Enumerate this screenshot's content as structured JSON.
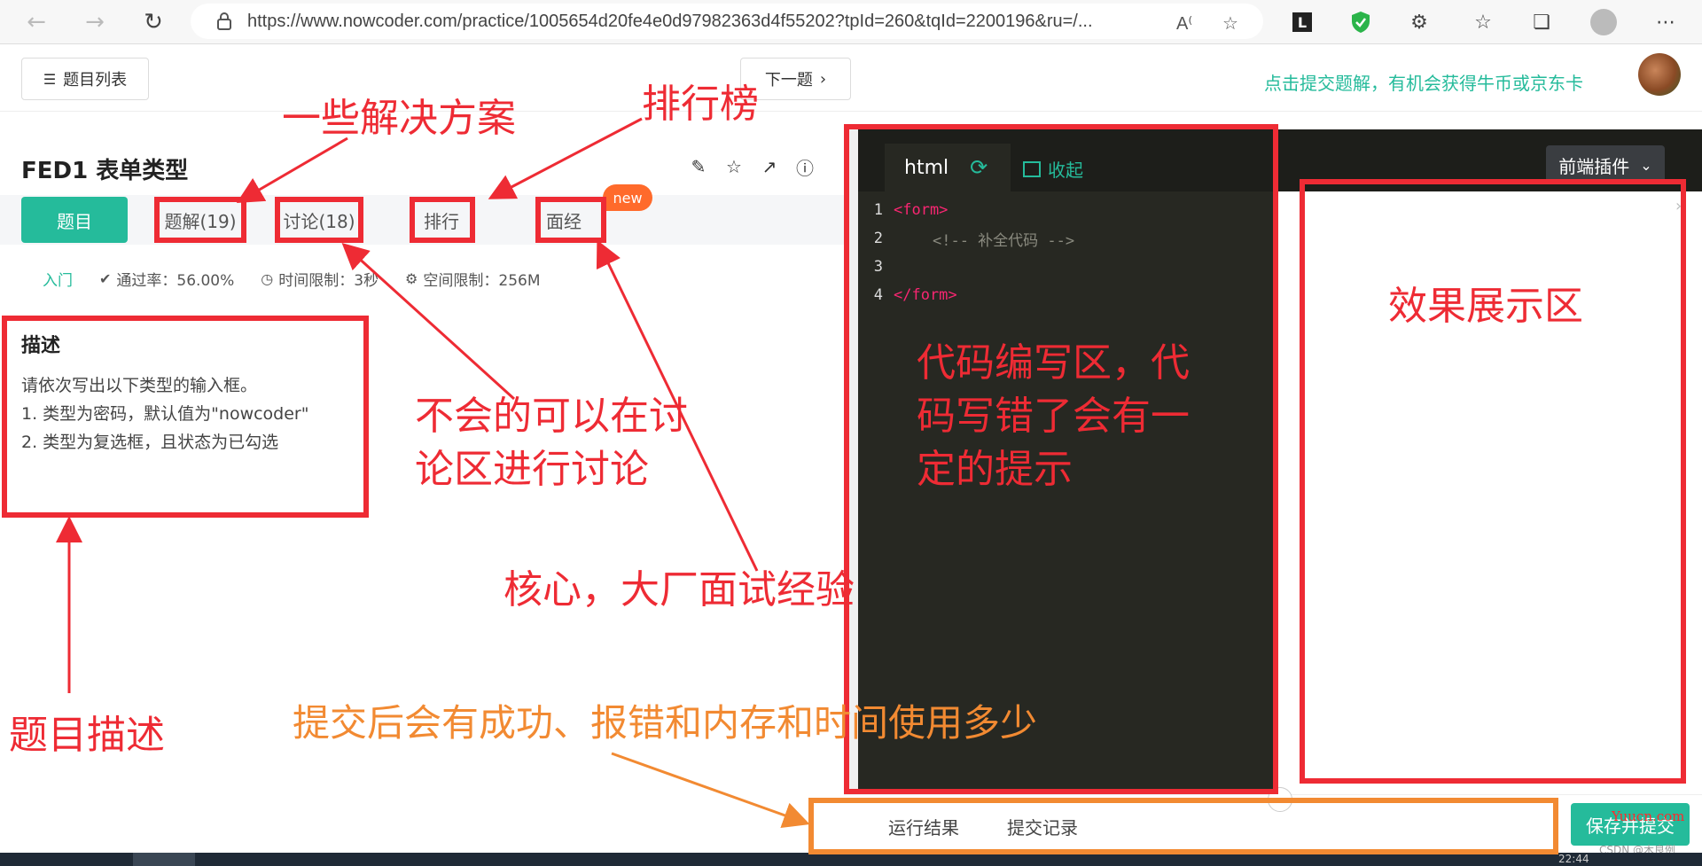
{
  "browser": {
    "url": "https://www.nowcoder.com/practice/1005654d20fe4e0d97982363d4f55202?tpId=260&tqId=2200196&ru=/..."
  },
  "page_top": {
    "list_label": "题目列表",
    "next_label": "下一题",
    "promo_text": "点击提交题解，有机会获得牛币或京东卡"
  },
  "problem": {
    "title": "FED1  表单类型",
    "tabs": [
      {
        "label": "题目"
      },
      {
        "label": "题解(19)"
      },
      {
        "label": "讨论(18)"
      },
      {
        "label": "排行"
      },
      {
        "label": "面经"
      }
    ],
    "new_badge": "new",
    "level": "入门",
    "pass_rate": "通过率：56.00%",
    "time_limit": "时间限制：3秒",
    "space_limit": "空间限制：256M",
    "desc_title": "描述",
    "desc_lines": [
      "请依次写出以下类型的输入框。",
      "1. 类型为密码，默认值为\"nowcoder\"",
      "2. 类型为复选框，且状态为已勾选"
    ]
  },
  "editor": {
    "lang_tab": "html",
    "collapse_label": "收起",
    "plugin_label": "前端插件",
    "lines": [
      {
        "no": "1",
        "tag": "<form>",
        "comment": ""
      },
      {
        "no": "2",
        "tag": "",
        "comment": "<!-- 补全代码 -->"
      },
      {
        "no": "3",
        "tag": "",
        "comment": ""
      },
      {
        "no": "4",
        "tag": "</form>",
        "comment": ""
      }
    ]
  },
  "bottom": {
    "run_result": "运行结果",
    "submit_record": "提交记录",
    "submit_button": "保存并提交",
    "watermark": "Yuucn.com",
    "csdn_mark": "CSDN @木良例",
    "clock": "22:44"
  },
  "annotations": {
    "solutions": "一些解决方案",
    "leaderboard": "排行榜",
    "discuss": [
      "不会的可以在讨",
      "论区进行讨论"
    ],
    "interview": "核心，大厂面试经验",
    "desc_label": "题目描述",
    "submit_info": "提交后会有成功、报错和内存和时间使用多少",
    "code_area": [
      "代码编写区，代",
      "码写错了会有一",
      "定的提示"
    ],
    "preview_area": "效果展示区",
    "red": "#ee2b34",
    "orange": "#f28a32"
  },
  "colors": {
    "brand_green": "#25bb9b",
    "editor_bg": "#272822",
    "new_badge": "#ff6a2b"
  }
}
